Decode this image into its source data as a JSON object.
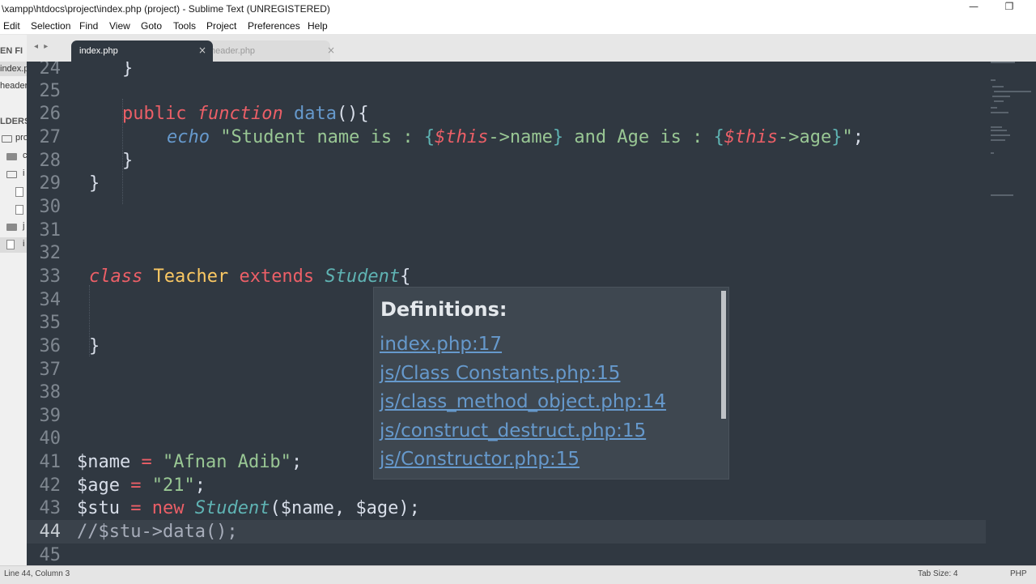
{
  "window": {
    "title": "\\xampp\\htdocs\\project\\index.php (project) - Sublime Text (UNREGISTERED)",
    "minimize": "—",
    "maximize": "❐"
  },
  "menu": [
    "Edit",
    "Selection",
    "Find",
    "View",
    "Goto",
    "Tools",
    "Project",
    "Preferences",
    "Help"
  ],
  "sidebar": {
    "open_files_header": "EN FI",
    "open_files": [
      "index.p",
      "header"
    ],
    "folders_header": "LDERS",
    "tree": [
      "pro",
      "c",
      "i",
      "j",
      "i"
    ]
  },
  "tabs": [
    {
      "label": "index.php",
      "close": "×",
      "active": true
    },
    {
      "label": "header.php",
      "close": "×",
      "active": false
    }
  ],
  "tab_nav": "◂ ▸",
  "editor": {
    "current_line": 44,
    "line_numbers": [
      "24",
      "25",
      "26",
      "27",
      "28",
      "29",
      "30",
      "31",
      "32",
      "33",
      "34",
      "35",
      "36",
      "37",
      "38",
      "39",
      "40",
      "41",
      "42",
      "43",
      "44",
      "45"
    ],
    "code": {
      "l24_brace": "}",
      "l26_public": "public",
      "l26_function": "function",
      "l26_name": "data",
      "l26_rest": "(){",
      "l27_echo": "echo",
      "l27_q1": "\"Student name is : ",
      "l27_ob1": "{",
      "l27_this1": "$this",
      "l27_arrow1": "->",
      "l27_prop1": "name",
      "l27_cb1": "}",
      "l27_mid": " and Age is : ",
      "l27_ob2": "{",
      "l27_this2": "$this",
      "l27_arrow2": "->",
      "l27_prop2": "age",
      "l27_cb2": "}",
      "l27_q2": "\"",
      "l27_semi": ";",
      "l28_brace": "}",
      "l29_brace": "}",
      "l33_class": "class",
      "l33_name": "Teacher",
      "l33_extends": "extends",
      "l33_parent": "Student",
      "l33_brace": "{",
      "l36_brace": "}",
      "l41_var": "$name",
      "l41_eq": " = ",
      "l41_str": "\"Afnan Adib\"",
      "l41_semi": ";",
      "l42_var": "$age",
      "l42_eq": " = ",
      "l42_str": "\"21\"",
      "l42_semi": ";",
      "l43_var": "$stu",
      "l43_eq": " = ",
      "l43_new": "new",
      "l43_cls": "Student",
      "l43_open": "(",
      "l43_a1": "$name",
      "l43_comma": ", ",
      "l43_a2": "$age",
      "l43_close": ");",
      "l44_comment": "//$stu->data();"
    }
  },
  "popup": {
    "heading": "Definitions:",
    "links": [
      "index.php:17",
      "js/Class Constants.php:15",
      "js/class_method_object.php:14",
      "js/construct_destruct.php:15",
      "js/Constructor.php:15"
    ]
  },
  "statusbar": {
    "position": "Line 44, Column 3",
    "tab_size": "Tab Size: 4",
    "syntax": "PHP"
  },
  "colors": {
    "editor_bg": "#303841",
    "keyword": "#ec5f67",
    "function": "#6699cc",
    "string": "#99c794",
    "class_name": "#fac863",
    "type": "#5fb3b3",
    "link": "#6699cc"
  }
}
